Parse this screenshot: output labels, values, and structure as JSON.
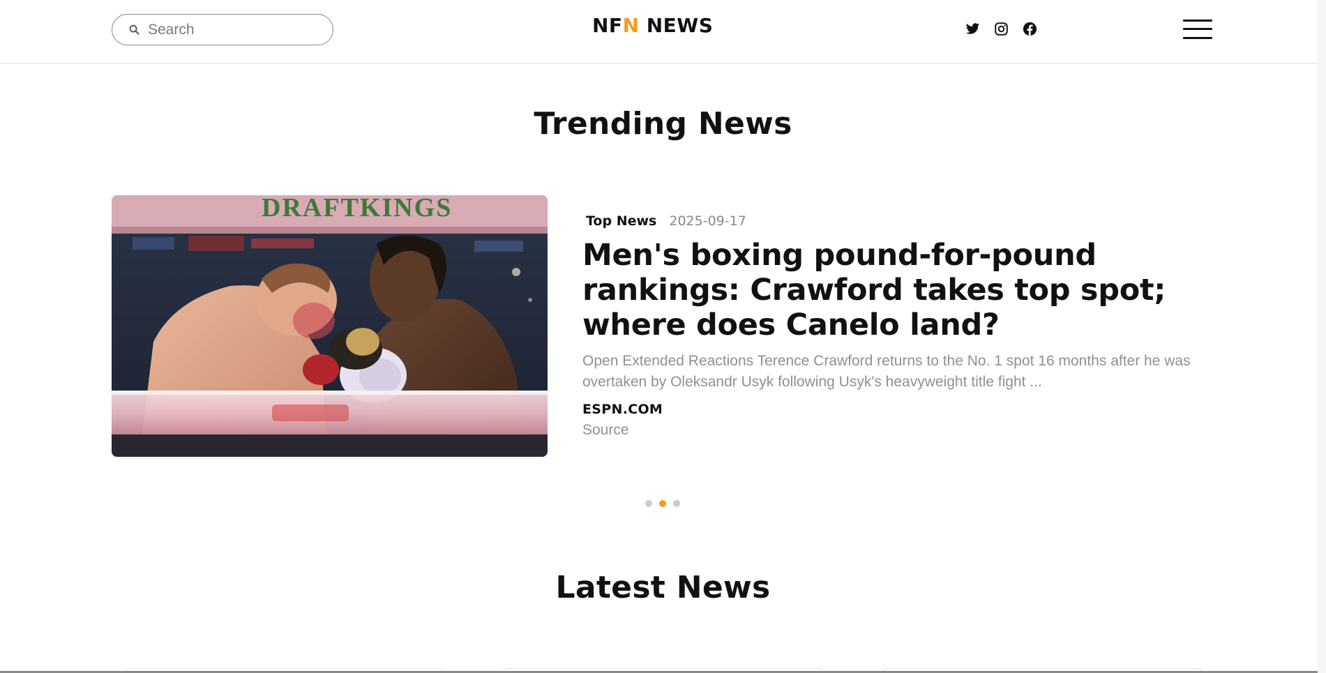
{
  "header": {
    "search_placeholder": "Search",
    "logo_prefix": "NF",
    "logo_accent": "N",
    "logo_suffix": " NEWS",
    "accent_color": "#f29a1f",
    "social_icons": [
      "twitter-icon",
      "instagram-icon",
      "facebook-icon"
    ],
    "menu_icon": "hamburger-menu-icon"
  },
  "trending": {
    "title": "Trending News",
    "article": {
      "category": "Top News",
      "date": "2025-09-17",
      "headline": "Men's boxing pound-for-pound rankings: Crawford takes top spot; where does Canelo land?",
      "summary": "Open Extended Reactions Terence Crawford returns to the No. 1 spot 16 months after he was overtaken by Oleksandr Usyk following Usyk's heavyweight title fight ...",
      "source_name": "ESPN.COM",
      "source_label": "Source",
      "image_banner_text": "DRAFTKINGS"
    },
    "carousel": {
      "total_slides": 3,
      "active_slide": 2
    }
  },
  "latest": {
    "title": "Latest News"
  }
}
